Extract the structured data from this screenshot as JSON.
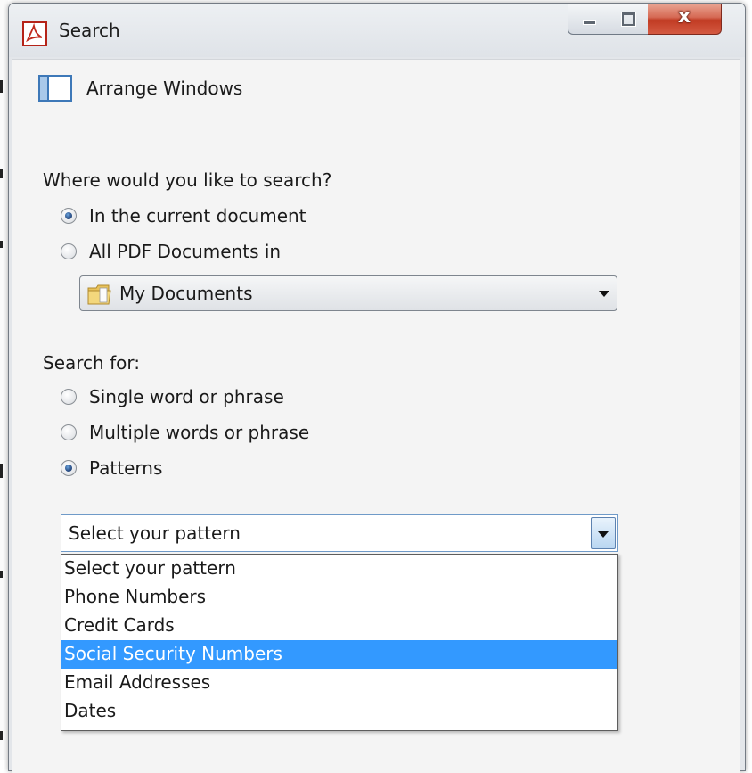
{
  "window": {
    "title": "Search",
    "close_glyph": "x",
    "app_icon": "adobe-acrobat-icon"
  },
  "toolbar": {
    "arrange_label": "Arrange Windows",
    "arrange_icon": "arrange-windows-icon"
  },
  "where": {
    "label": "Where would you like to search?",
    "options": [
      {
        "label": "In the current document",
        "checked": true
      },
      {
        "label": "All PDF Documents in",
        "checked": false
      }
    ],
    "location": {
      "value": "My Documents",
      "icon": "folder-icon"
    }
  },
  "search_for": {
    "label": "Search for:",
    "options": [
      {
        "label": "Single word or phrase",
        "checked": false
      },
      {
        "label": "Multiple words or phrase",
        "checked": false
      },
      {
        "label": "Patterns",
        "checked": true
      }
    ]
  },
  "pattern": {
    "value": "Select your pattern",
    "options": [
      "Select your pattern",
      "Phone Numbers",
      "Credit Cards",
      "Social Security Numbers",
      "Email Addresses",
      "Dates"
    ],
    "highlighted": "Social Security Numbers"
  },
  "colors": {
    "highlight": "#3399ff",
    "close_button": "#c13b23"
  }
}
